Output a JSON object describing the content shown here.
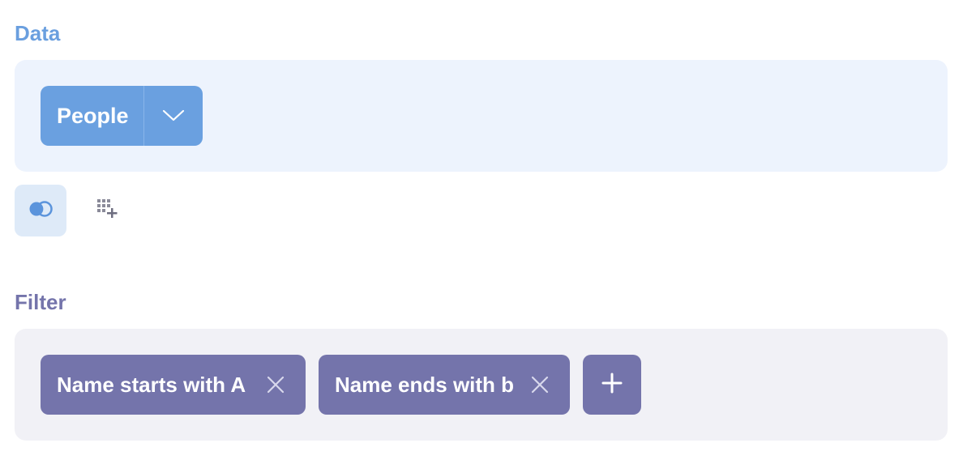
{
  "data_section": {
    "title": "Data",
    "source": {
      "label": "People",
      "dropdown_icon": "chevron-down-icon"
    },
    "actions": [
      {
        "name": "join",
        "icon": "join-icon"
      },
      {
        "name": "custom-column",
        "icon": "add-column-icon"
      }
    ]
  },
  "filter_section": {
    "title": "Filter",
    "filters": [
      {
        "label": "Name starts with A",
        "remove_icon": "close-icon"
      },
      {
        "label": "Name ends with b",
        "remove_icon": "close-icon"
      }
    ],
    "add_icon": "plus-icon"
  },
  "colors": {
    "data_accent": "#6aa0e0",
    "data_title": "#6a9fdf",
    "data_panel_bg": "#edf3fd",
    "filter_accent": "#7474ab",
    "filter_panel_bg": "#f1f1f6"
  }
}
